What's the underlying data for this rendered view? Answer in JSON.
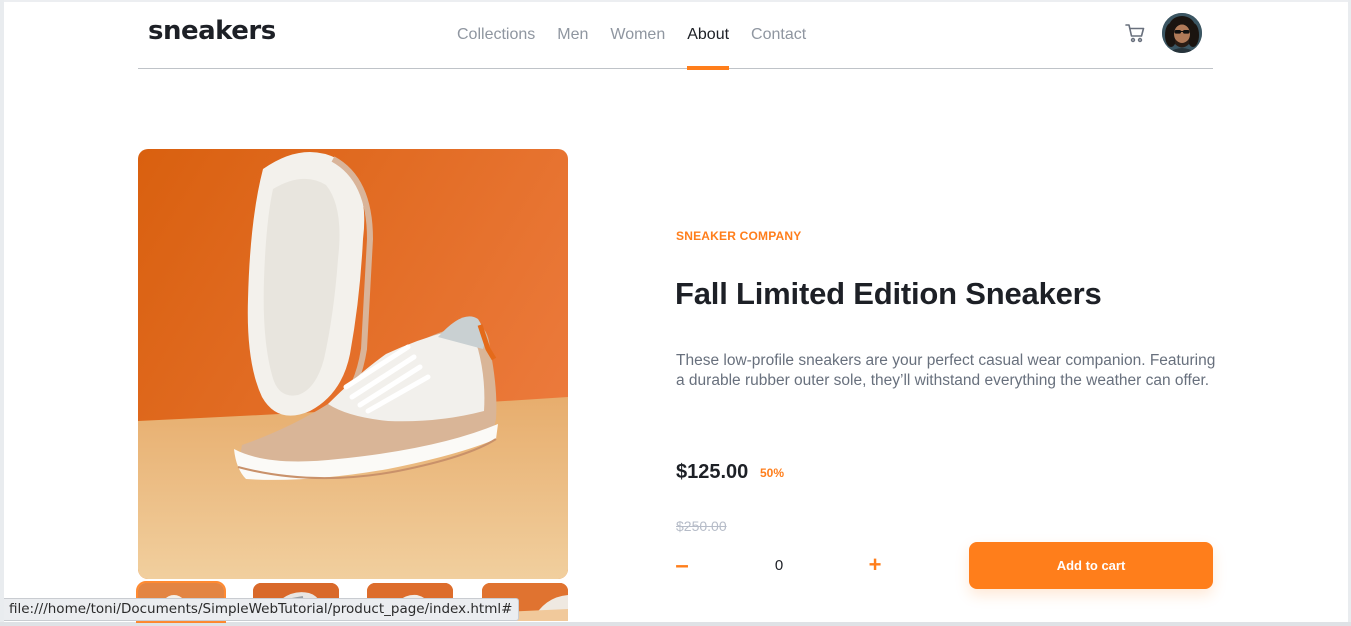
{
  "header": {
    "logo": "sneakers",
    "nav": [
      {
        "label": "Collections",
        "active": false
      },
      {
        "label": "Men",
        "active": false
      },
      {
        "label": "Women",
        "active": false
      },
      {
        "label": "About",
        "active": true
      },
      {
        "label": "Contact",
        "active": false
      }
    ],
    "cart_icon": "cart-icon",
    "avatar_icon": "avatar"
  },
  "gallery": {
    "main_image": "product-image",
    "thumbnails": [
      "thumbnail-1",
      "thumbnail-2",
      "thumbnail-3",
      "thumbnail-4"
    ]
  },
  "product": {
    "company": "SNEAKER COMPANY",
    "title": "Fall Limited Edition Sneakers",
    "description": "These low-profile sneakers are your perfect casual wear companion. Featuring a durable rubber outer sole, they’ll withstand everything the weather can offer.",
    "price": "$125.00",
    "discount": "50%",
    "old_price": "$250.00"
  },
  "quantity": {
    "minus": "–",
    "value": "0",
    "plus": "+"
  },
  "cart_button": {
    "label": "Add to cart"
  },
  "status_bar": {
    "url": "file:///home/toni/Documents/SimpleWebTutorial/product_page/index.html#"
  },
  "colors": {
    "accent": "#ff7e1b",
    "text_dark": "#1d2026",
    "text_muted": "#68707d"
  }
}
